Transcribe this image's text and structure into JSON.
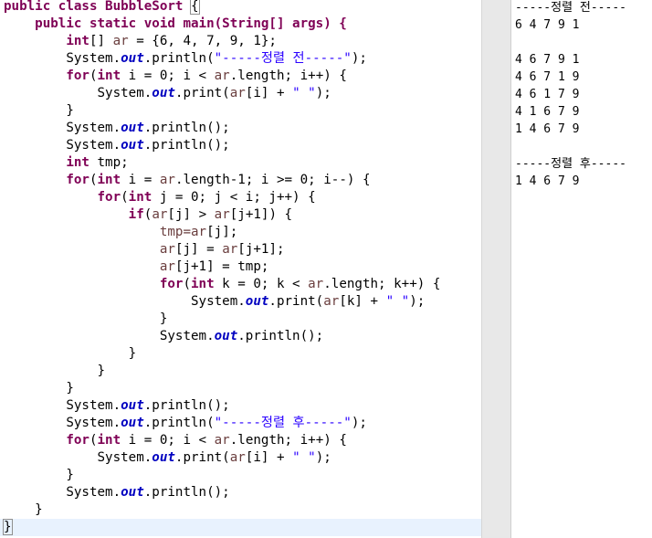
{
  "editor": {
    "class_decl": "public class BubbleSort ",
    "open_brace": "{",
    "main_decl": "public static void main(String[] args) {",
    "int_arr_type": "int",
    "arr_rest_a": "[] ",
    "arr_name": "ar",
    "arr_rest_b": " = {6, 4, 7, 9, 1};",
    "system": "System.",
    "out": "out",
    "println_open": ".println(",
    "print_open": ".print(",
    "println_empty": ".println();",
    "str_before": "\"-----정렬 전-----\"",
    "str_after": "\"-----정렬 후-----\"",
    "str_space": "\" \"",
    "close_paren_semi": ");",
    "for_kw": "for",
    "if_kw": "if",
    "int_kw": "int",
    "tmp_decl": " tmp;",
    "loop1_a": "(",
    "loop1_b": " i = 0; i < ",
    "loop1_c": ".length; i++) {",
    "print_arr_i_a": "(",
    "print_arr_i_b": "[i] + ",
    "print_arr_i_c": ");",
    "close_brace": "}",
    "outer_for_b": " i = ",
    "outer_for_c": ".length-1; i >= 0; i--) {",
    "inner_for_b": " j = 0; j < i; j++) {",
    "if_a": "(",
    "if_b": "[j] > ",
    "if_c": "[j+1]) {",
    "swap1_a": "tmp=",
    "swap1_b": "[j];",
    "swap2_b": "[j] = ",
    "swap2_c": "[j+1];",
    "swap3_b": "[j+1] = tmp;",
    "inner_k_b": " k = 0; k < ",
    "inner_k_c": ".length; k++) {",
    "print_arr_k_b": "[k] + "
  },
  "console": {
    "header_before": "-----정렬 전-----",
    "initial": "6 4 7 9 1",
    "passes": [
      "4 6 7 9 1",
      "4 6 7 1 9",
      "4 6 1 7 9",
      "4 1 6 7 9",
      "1 4 6 7 9"
    ],
    "header_after": "-----정렬 후-----",
    "final": "1 4 6 7 9"
  }
}
